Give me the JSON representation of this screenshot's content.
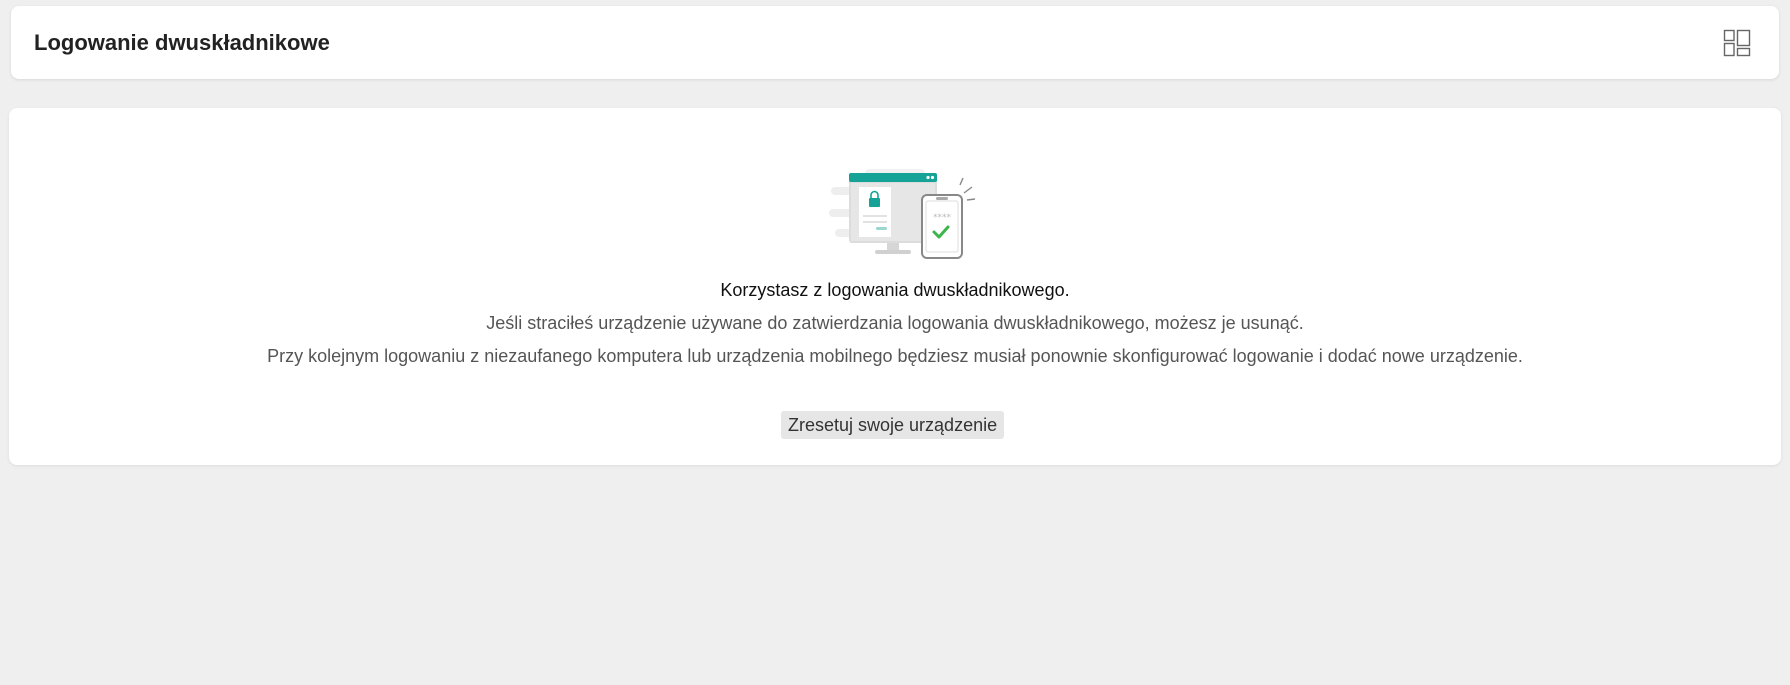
{
  "header": {
    "title": "Logowanie dwuskładnikowe",
    "layout_icon": "grid-layout-icon"
  },
  "main": {
    "illustration_icon": "two-factor-device-illustration",
    "status_text": "Korzystasz z logowania dwuskładnikowego.",
    "info_line_1": "Jeśli straciłeś urządzenie używane do zatwierdzania logowania dwuskładnikowego, możesz je usunąć.",
    "info_line_2": "Przy kolejnym logowaniu z niezaufanego komputera lub urządzenia mobilnego będziesz musiał ponownie skonfigurować logowanie i dodać nowe urządzenie.",
    "reset_button_label": "Zresetuj swoje urządzenie"
  },
  "colors": {
    "background": "#efefef",
    "card": "#ffffff",
    "accent": "#14a396",
    "check": "#3cb54a",
    "button_bg": "#e6e6e6"
  }
}
